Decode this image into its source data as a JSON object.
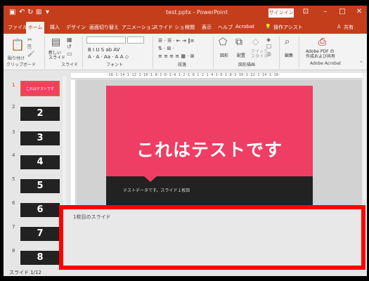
{
  "window": {
    "title": "test.pptx - PowerPoint",
    "signin_label": "サインイン"
  },
  "menu": {
    "tabs": [
      "ファイル",
      "ホーム",
      "挿入",
      "デザイン",
      "画面切り替え",
      "アニメーション",
      "スライド ショー",
      "校閲",
      "表示",
      "ヘルプ",
      "Acrobat"
    ],
    "tell_me": "操作アシスト",
    "share": "共有"
  },
  "ribbon": {
    "paste": "貼り付け",
    "new_slide": "新しい\nスライド",
    "groups": [
      "クリップボード",
      "スライド",
      "フォント",
      "段落",
      "図形描画",
      "Adobe Acrobat"
    ],
    "shapes": "図形",
    "arrange": "配置",
    "quick_styles": "クイック\nスタイル",
    "edit": "編集",
    "adobe_pdf": "Adobe PDF の\n作成および共有"
  },
  "thumbnails": [
    {
      "num": "1",
      "label": "これはテストです"
    },
    {
      "num": "2",
      "label": "2"
    },
    {
      "num": "3",
      "label": "3"
    },
    {
      "num": "4",
      "label": "4"
    },
    {
      "num": "5",
      "label": "5"
    },
    {
      "num": "6",
      "label": "6"
    },
    {
      "num": "7",
      "label": "7"
    },
    {
      "num": "8",
      "label": "8"
    }
  ],
  "ruler": "·16·1·14·1·12·1·10·1·8·1·6·1·4·1·2·1·0·1·2·1·4·1·6·1·8·1·10·1·12·1·14·1·16·",
  "slide": {
    "title": "これはテストです",
    "subtitle": "テストデータです。スライド１枚目"
  },
  "notes": {
    "text": "1枚目のスライド"
  },
  "status": {
    "slide_counter": "スライド 1/12"
  },
  "colors": {
    "accent": "#c43e1c",
    "slide_bg": "#ee3e63",
    "highlight": "#ff0000"
  }
}
